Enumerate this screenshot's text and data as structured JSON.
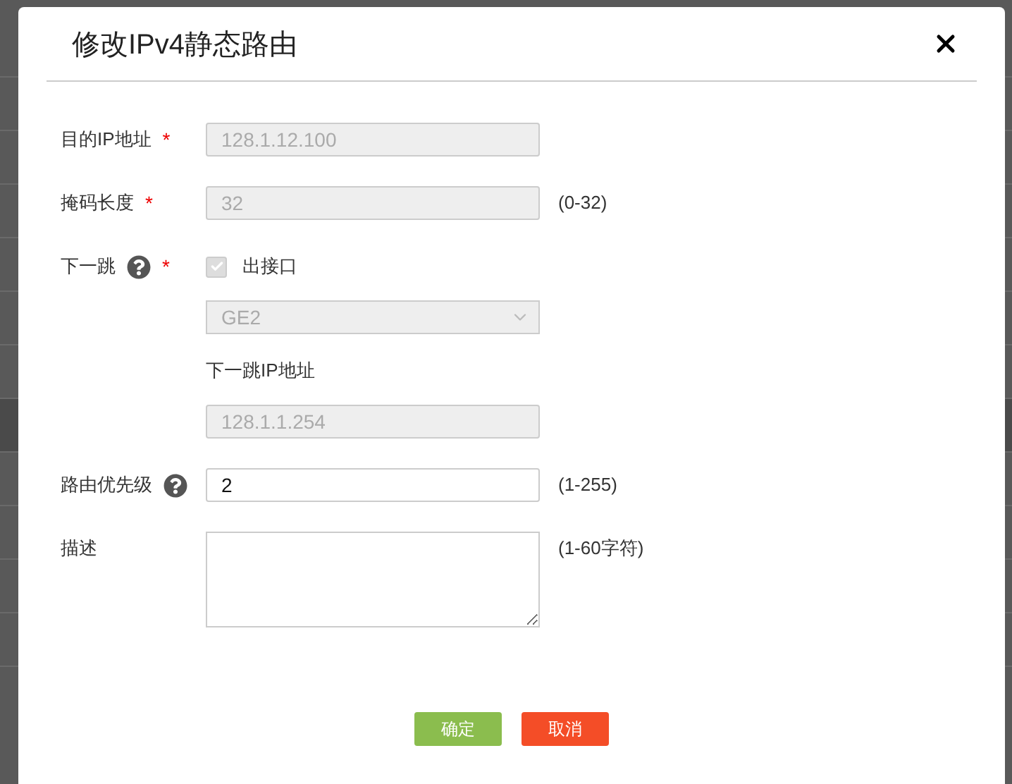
{
  "dialog": {
    "title": "修改IPv4静态路由",
    "fields": [
      {
        "kind": "input",
        "label": "目的IP地址",
        "required_mark": "*",
        "help": false,
        "value": "128.1.12.100",
        "disabled": true
      },
      {
        "kind": "input",
        "label": "掩码长度",
        "required_mark": "*",
        "help": false,
        "value": "32",
        "disabled": true,
        "hint": "(0-32)"
      },
      {
        "kind": "nexthop",
        "label": "下一跳",
        "required_mark": "*",
        "help": true,
        "checkbox": {
          "label": "出接口",
          "checked": true,
          "disabled": true
        },
        "select": {
          "value": "GE2",
          "disabled": true
        },
        "sublabel": "下一跳IP地址",
        "ip": {
          "value": "128.1.1.254",
          "disabled": true
        }
      },
      {
        "kind": "input",
        "label": "路由优先级",
        "help": true,
        "value": "2",
        "disabled": false,
        "hint": "(1-255)"
      },
      {
        "kind": "textarea",
        "label": "描述",
        "help": false,
        "hint": "(1-60字符)"
      }
    ],
    "buttons": [
      {
        "label": "确定",
        "kind": "primary"
      },
      {
        "label": "取消",
        "kind": "danger"
      }
    ]
  }
}
